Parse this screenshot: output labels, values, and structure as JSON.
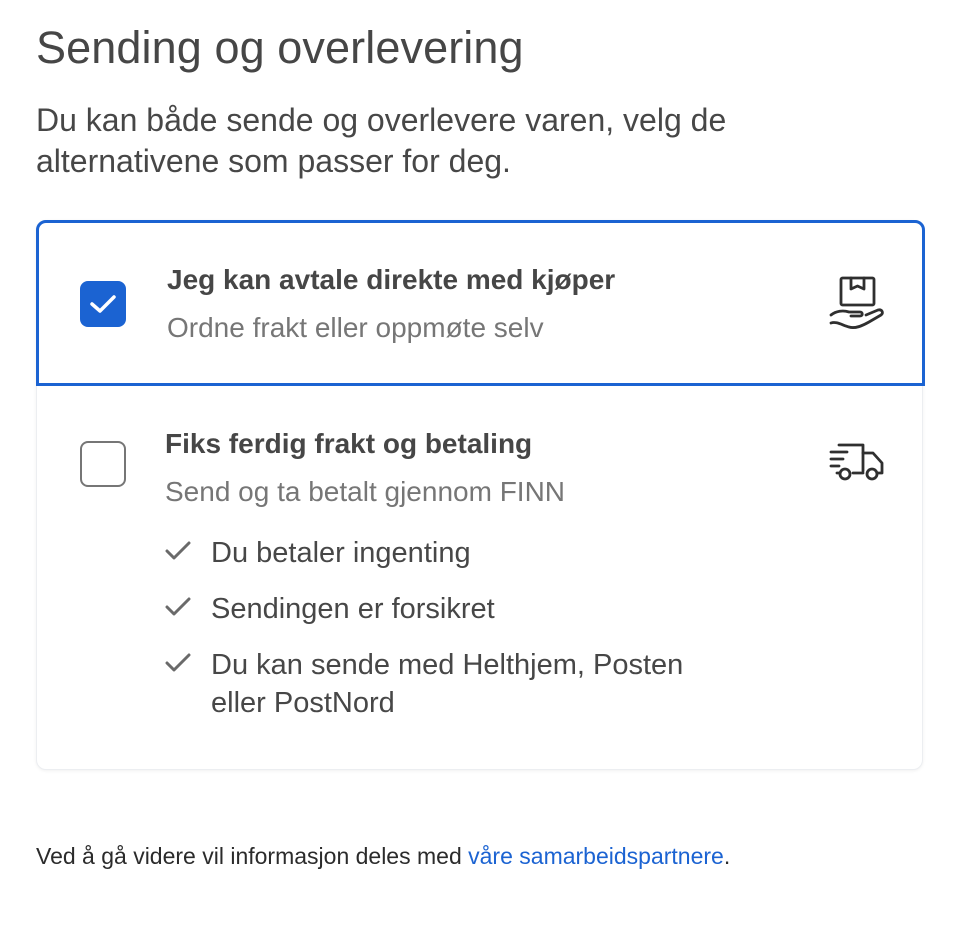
{
  "header": {
    "title": "Sending og overlevering",
    "intro": "Du kan både sende og overlevere varen, velg de alternativene som passer for deg."
  },
  "options": [
    {
      "title": "Jeg kan avtale direkte med kjøper",
      "subtitle": "Ordne frakt eller oppmøte selv",
      "checked": true,
      "icon": "hand-package-icon"
    },
    {
      "title": "Fiks ferdig frakt og betaling",
      "subtitle": "Send og ta betalt gjennom FINN",
      "checked": false,
      "icon": "delivery-truck-icon",
      "benefits": [
        "Du betaler ingenting",
        "Sendingen er forsikret",
        "Du kan sende med Helthjem, Posten eller PostNord"
      ]
    }
  ],
  "footer": {
    "text": "Ved å gå videre vil informasjon deles med ",
    "link_text": "våre samarbeidspartnere",
    "suffix": "."
  },
  "colors": {
    "accent": "#1b63d2",
    "text": "#464646",
    "muted": "#767676"
  }
}
